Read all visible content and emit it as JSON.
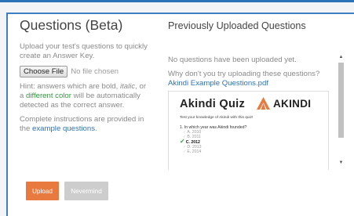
{
  "left": {
    "title": "Questions (Beta)",
    "upload_intro": "Upload your test's questions to quickly create an Answer Key.",
    "choose_file_label": "Choose File",
    "file_status": "No file chosen",
    "hint_prefix": "Hint: answers which are bold, ",
    "hint_italic": "italic",
    "hint_or": ", or a ",
    "hint_green": "different color",
    "hint_suffix": " will be automatically detected as the correct answer.",
    "instructions_prefix": "Complete instructions are provided in the ",
    "instructions_link": "example questions",
    "instructions_suffix": "."
  },
  "right": {
    "title": "Previously Uploaded Questions",
    "none_text": "No questions have been uploaded yet.",
    "why_text": "Why don't you try uploading these questions?",
    "example_link": "Akindi Example Questions.pdf"
  },
  "preview": {
    "quiz_title": "Akindi Quiz",
    "brand_name": "AKINDI",
    "brand_color": "#e8793f",
    "intro": "Test your knowledge of Akindi with this quiz!",
    "question": "1.  In which year was Akindi founded?",
    "options": [
      {
        "label": "A.  2010",
        "correct": false
      },
      {
        "label": "B.  2011",
        "correct": false
      },
      {
        "label": "C.  2012",
        "correct": true
      },
      {
        "label": "D.  2013",
        "correct": false
      },
      {
        "label": "E.  2014",
        "correct": false
      }
    ]
  },
  "buttons": {
    "upload": "Upload",
    "nevermind": "Nevermind"
  },
  "colors": {
    "accent_blue": "#2c73b8",
    "link_blue": "#2d73b8",
    "upload_orange": "#e8793f",
    "nevermind_gray": "#cdcdcd",
    "green": "#2e9a3c"
  }
}
